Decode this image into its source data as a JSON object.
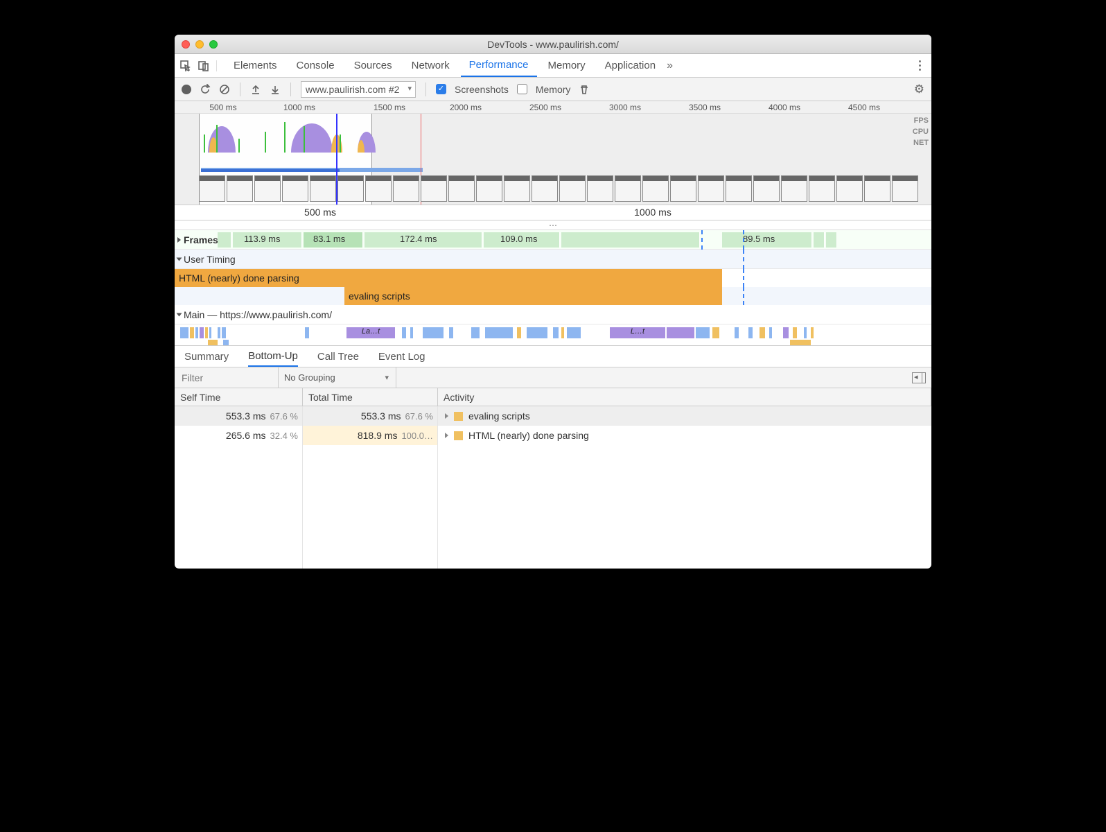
{
  "window": {
    "title": "DevTools - www.paulirish.com/"
  },
  "panels": [
    "Elements",
    "Console",
    "Sources",
    "Network",
    "Performance",
    "Memory",
    "Application"
  ],
  "activePanel": "Performance",
  "toolbar": {
    "profileSelect": "www.paulirish.com #2",
    "screenshotsLabel": "Screenshots",
    "screenshotsChecked": true,
    "memoryLabel": "Memory",
    "memoryChecked": false
  },
  "overview": {
    "ticks": [
      "500 ms",
      "1000 ms",
      "1500 ms",
      "2000 ms",
      "2500 ms",
      "3000 ms",
      "3500 ms",
      "4000 ms",
      "4500 ms"
    ],
    "labels": {
      "fps": "FPS",
      "cpu": "CPU",
      "net": "NET"
    }
  },
  "ruler": {
    "ticks": [
      "500 ms",
      "1000 ms"
    ]
  },
  "frames": {
    "label": "Frames",
    "values": [
      "113.9 ms",
      "83.1 ms",
      "172.4 ms",
      "109.0 ms",
      "89.5 ms"
    ]
  },
  "userTiming": {
    "label": "User Timing",
    "bars": [
      {
        "label": "HTML (nearly) done parsing"
      },
      {
        "label": "evaling scripts"
      }
    ]
  },
  "mainThread": {
    "label": "Main — https://www.paulirish.com/"
  },
  "detailTabs": [
    "Summary",
    "Bottom-Up",
    "Call Tree",
    "Event Log"
  ],
  "activeDetailTab": "Bottom-Up",
  "filter": {
    "placeholder": "Filter",
    "grouping": "No Grouping"
  },
  "columns": {
    "selfTime": "Self Time",
    "totalTime": "Total Time",
    "activity": "Activity"
  },
  "rows": [
    {
      "selfMs": "553.3 ms",
      "selfPct": "67.6 %",
      "totalMs": "553.3 ms",
      "totalPct": "67.6 %",
      "activity": "evaling scripts",
      "selected": true
    },
    {
      "selfMs": "265.6 ms",
      "selfPct": "32.4 %",
      "totalMs": "818.9 ms",
      "totalPct": "100.0…",
      "activity": "HTML (nearly) done parsing",
      "selected": false,
      "pctYellow": true,
      "totalYellowBg": true
    }
  ],
  "flameLabels": {
    "layout1": "La…t",
    "layout2": "L…t"
  }
}
